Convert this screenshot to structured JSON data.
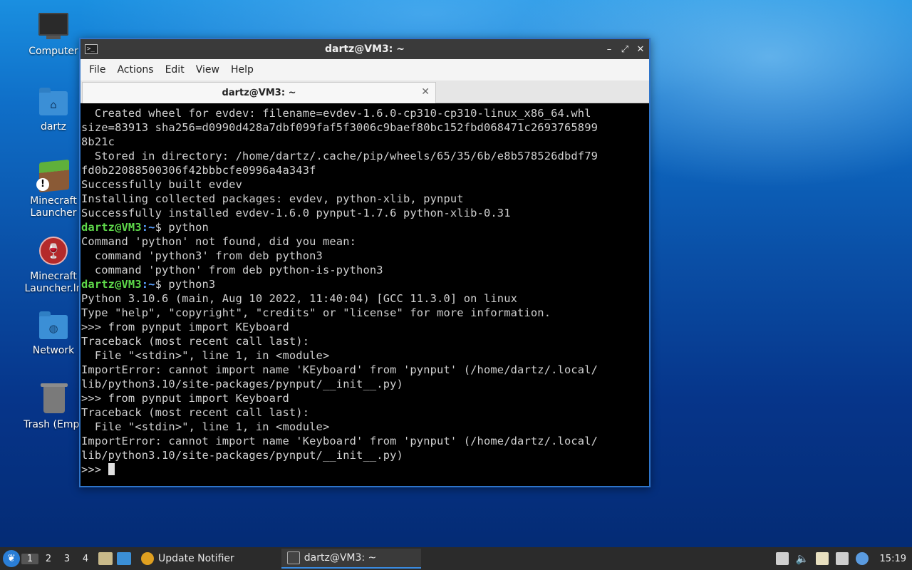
{
  "desktop": {
    "icons": [
      {
        "label": "Computer"
      },
      {
        "label": "dartz"
      },
      {
        "label": "Minecraft Launcher"
      },
      {
        "label": "Minecraft Launcher.ln"
      },
      {
        "label": "Network"
      },
      {
        "label": "Trash (Empt"
      }
    ]
  },
  "window": {
    "title": "dartz@VM3: ~",
    "menu": [
      "File",
      "Actions",
      "Edit",
      "View",
      "Help"
    ],
    "tab_label": "dartz@VM3: ~",
    "tab_close": "✕"
  },
  "terminal": {
    "prompt_user": "dartz@VM3",
    "prompt_path": ":~",
    "lines": [
      "  Created wheel for evdev: filename=evdev-1.6.0-cp310-cp310-linux_x86_64.whl",
      "size=83913 sha256=d0990d428a7dbf099faf5f3006c9baef80bc152fbd068471c2693765899",
      "8b21c",
      "  Stored in directory: /home/dartz/.cache/pip/wheels/65/35/6b/e8b578526dbdf79",
      "fd0b22088500306f42bbbcfe0996a4a343f",
      "Successfully built evdev",
      "Installing collected packages: evdev, python-xlib, pynput",
      "Successfully installed evdev-1.6.0 pynput-1.7.6 python-xlib-0.31",
      "$ python",
      "Command 'python' not found, did you mean:",
      "  command 'python3' from deb python3",
      "  command 'python' from deb python-is-python3",
      "$ python3",
      "Python 3.10.6 (main, Aug 10 2022, 11:40:04) [GCC 11.3.0] on linux",
      "Type \"help\", \"copyright\", \"credits\" or \"license\" for more information.",
      ">>> from pynput import KEyboard",
      "Traceback (most recent call last):",
      "  File \"<stdin>\", line 1, in <module>",
      "ImportError: cannot import name 'KEyboard' from 'pynput' (/home/dartz/.local/",
      "lib/python3.10/site-packages/pynput/__init__.py)",
      ">>> from pynput import Keyboard",
      "Traceback (most recent call last):",
      "  File \"<stdin>\", line 1, in <module>",
      "ImportError: cannot import name 'Keyboard' from 'pynput' (/home/dartz/.local/",
      "lib/python3.10/site-packages/pynput/__init__.py)",
      ">>> "
    ]
  },
  "taskbar": {
    "workspaces": [
      "1",
      "2",
      "3",
      "4"
    ],
    "tasks": [
      {
        "label": "Update Notifier"
      },
      {
        "label": "dartz@VM3: ~"
      }
    ],
    "clock": "15:19"
  }
}
